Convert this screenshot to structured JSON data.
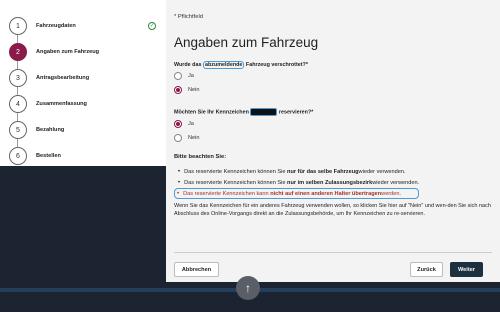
{
  "sidebar": {
    "steps": [
      {
        "number": "1",
        "label": "Fahrzeugdaten"
      },
      {
        "number": "2",
        "label": "Angaben zum Fahrzeug"
      },
      {
        "number": "3",
        "label": "Antragsbearbeitung"
      },
      {
        "number": "4",
        "label": "Zusammenfassung"
      },
      {
        "number": "5",
        "label": "Bezahlung"
      },
      {
        "number": "6",
        "label": "Bestellen"
      }
    ],
    "check_icon": "✓"
  },
  "main": {
    "required_note": "* Pflichtfeld",
    "title": "Angaben zum Fahrzeug",
    "q1": {
      "prefix": "Wurde das ",
      "highlight": "abzumeldende",
      "suffix": " Fahrzeug verschrottet?*",
      "options": [
        "Ja",
        "Nein"
      ],
      "selected": "Nein"
    },
    "q2": {
      "prefix": "Möchten Sie Ihr Kennzeichen ",
      "suffix": " reservieren?*",
      "options": [
        "Ja",
        "Nein"
      ],
      "selected": "Ja"
    },
    "notice": {
      "heading": "Bitte beachten Sie:",
      "bullets": [
        {
          "pre": "Das reservierte Kennzeichen können Sie ",
          "bold": "nur für das selbe Fahrzeug",
          "post": " wieder verwenden."
        },
        {
          "pre": "Das reservierte Kennzeichen können Sie ",
          "bold": "nur im selben Zulassungsbezirk",
          "post": " wieder verwenden."
        },
        {
          "pre": "Das reservierte Kennzeichen kann ",
          "bold": "nicht auf einen anderen Halter übertragen",
          "post": " werden."
        }
      ],
      "paragraph": "Wenn Sie das Kennzeichen für ein anderes Fahrzeug verwenden wollen, so klicken Sie hier auf \"Nein\" und wen-den Sie sich nach Abschluss des Online-Vorgangs direkt an die Zulassungsbehörde, um Ihr Kennzeichen zu re-servieren."
    },
    "buttons": {
      "abort": "Abbrechen",
      "back": "Zurück",
      "next": "Weiter"
    }
  },
  "fab_icon": "↑",
  "colors": {
    "accent": "#8a1a4a",
    "success": "#2e8b3a",
    "primary_button": "#1d3040",
    "warning_text": "#a0322a"
  }
}
